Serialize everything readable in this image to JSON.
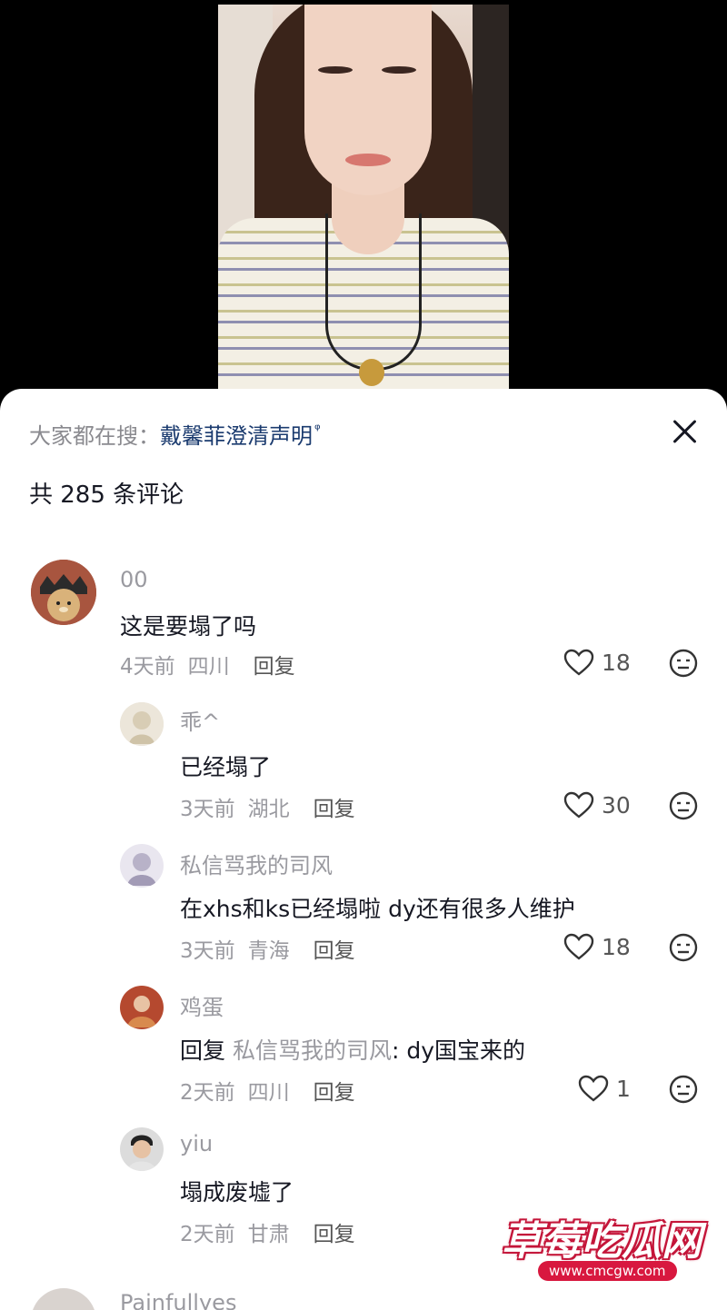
{
  "search": {
    "prefix": "大家都在搜：",
    "keyword": "戴馨菲澄清声明",
    "icon": "search-icon"
  },
  "header": {
    "count_text": "共 285 条评论"
  },
  "comments": [
    {
      "user": "00",
      "text": "这是要塌了吗",
      "time": "4天前",
      "location": "四川",
      "reply_label": "回复",
      "likes": "18"
    },
    {
      "user": "乖^",
      "text": "已经塌了",
      "time": "3天前",
      "location": "湖北",
      "reply_label": "回复",
      "likes": "30"
    },
    {
      "user": "私信骂我的司风",
      "text": "在xhs和ks已经塌啦 dy还有很多人维护",
      "time": "3天前",
      "location": "青海",
      "reply_label": "回复",
      "likes": "18"
    },
    {
      "user": "鸡蛋",
      "reply_prefix": "回复",
      "reply_to": "私信骂我的司风",
      "text": ": dy国宝来的",
      "time": "2天前",
      "location": "四川",
      "reply_label": "回复",
      "likes": "1"
    },
    {
      "user": "yiu",
      "text": "塌成废墟了",
      "time": "2天前",
      "location": "甘肃",
      "reply_label": "回复"
    },
    {
      "user": "Painfullyes"
    }
  ],
  "watermark": {
    "title": "草莓吃瓜网",
    "url": "www.cmcgw.com"
  },
  "colors": {
    "sheet_bg": "#ffffff",
    "accent_link": "#1b3b6f",
    "muted": "#9a9aa0",
    "watermark_red": "#d8183f"
  }
}
